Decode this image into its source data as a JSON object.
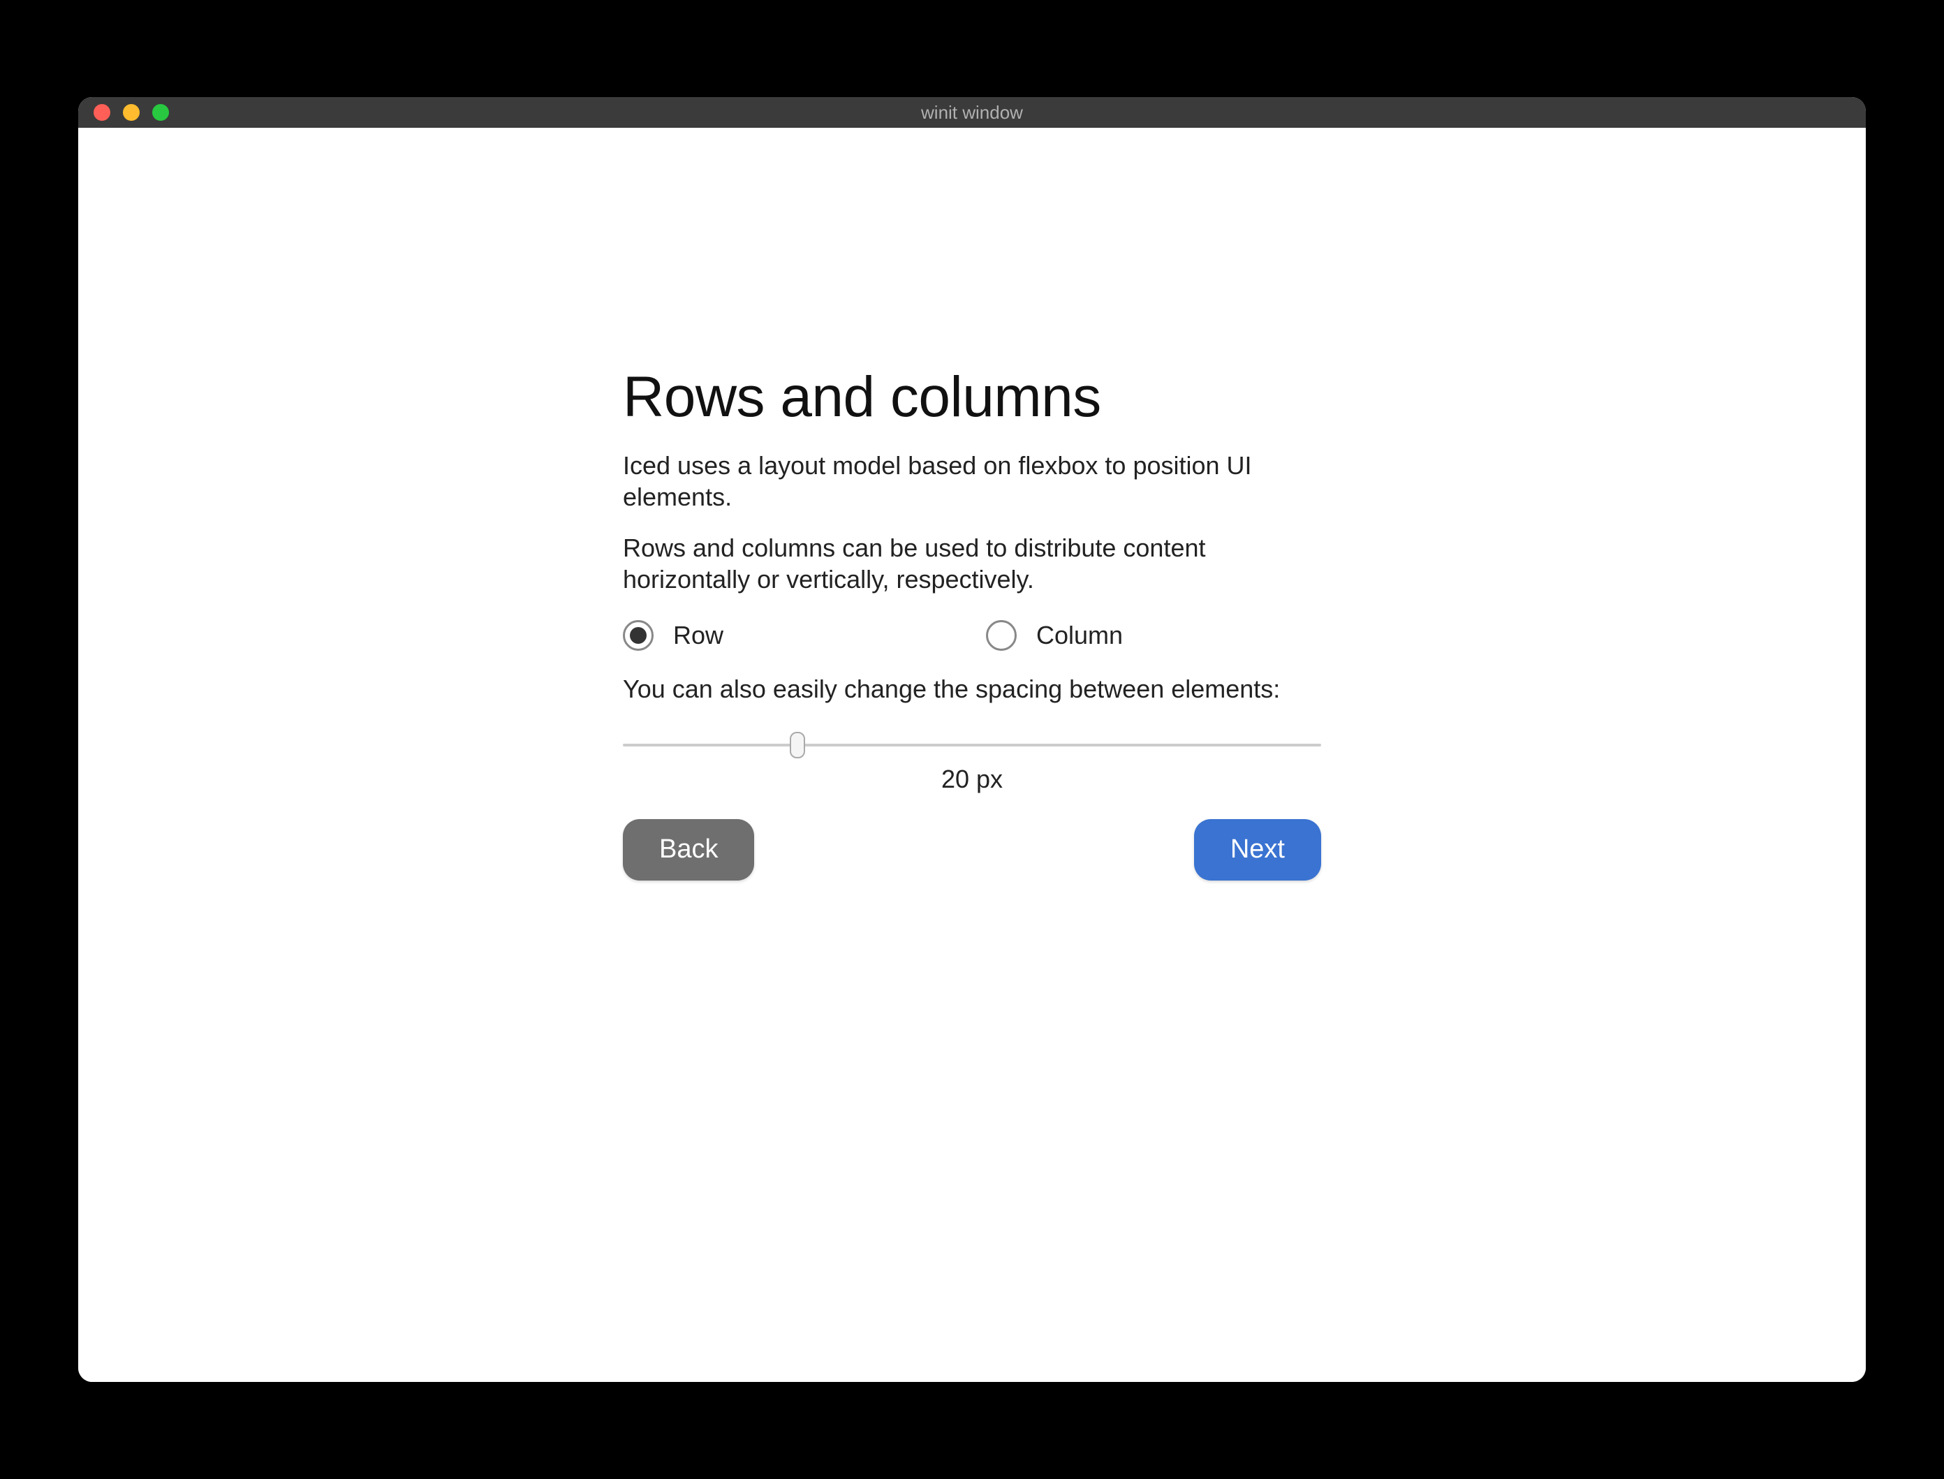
{
  "window": {
    "title": "winit window"
  },
  "content": {
    "heading": "Rows and columns",
    "paragraph1": "Iced uses a layout model based on flexbox to position UI elements.",
    "paragraph2": "Rows and columns can be used to distribute content horizontally or vertically, respectively.",
    "radio": {
      "row_label": "Row",
      "column_label": "Column",
      "selected": "row"
    },
    "spacing_text": "You can also easily change the spacing between elements:",
    "slider": {
      "min": 0,
      "max": 80,
      "value": 20,
      "value_label": "20 px"
    },
    "buttons": {
      "back_label": "Back",
      "next_label": "Next"
    }
  }
}
